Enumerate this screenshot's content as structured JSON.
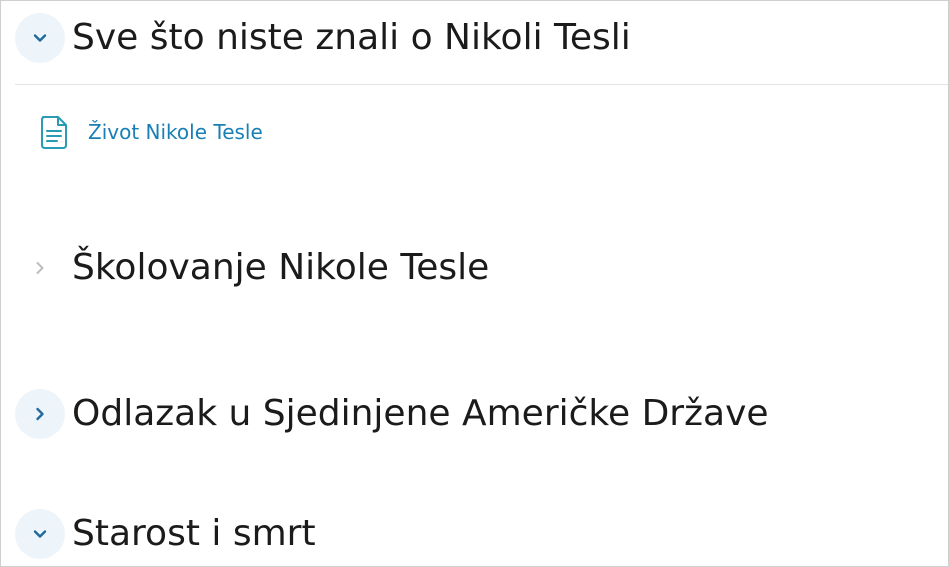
{
  "sections": [
    {
      "title": "Sve što niste znali o Nikoli Tesli",
      "state": "expanded",
      "toggle_icon": "chevron-down-icon"
    },
    {
      "title": "Školovanje Nikole Tesle",
      "state": "collapsed-disabled",
      "toggle_icon": "chevron-right-icon"
    },
    {
      "title": "Odlazak u Sjedinjene Američke Države",
      "state": "collapsed",
      "toggle_icon": "chevron-right-icon"
    },
    {
      "title": "Starost i smrt",
      "state": "expanded",
      "toggle_icon": "chevron-down-icon"
    }
  ],
  "activities": [
    {
      "label": "Život Nikole Tesle",
      "icon": "document-icon"
    }
  ],
  "colors": {
    "accent": "#1a7fb3",
    "chevron": "#1f6aa0",
    "chevron_disabled": "#bdbdbd",
    "toggle_bg": "#eef5fa",
    "title_text": "#1b1b1b",
    "divider": "#e2e2e2",
    "document_icon": "#2a9bb5"
  }
}
